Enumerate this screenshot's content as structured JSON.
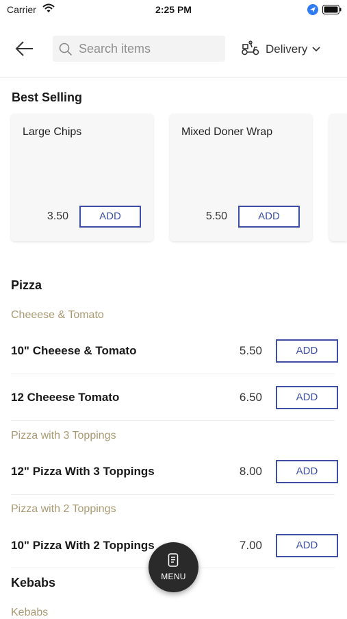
{
  "status_bar": {
    "carrier": "Carrier",
    "time": "2:25 PM"
  },
  "header": {
    "search_placeholder": "Search items",
    "delivery_label": "Delivery"
  },
  "best_selling": {
    "title": "Best Selling",
    "items": [
      {
        "name": "Large Chips",
        "price": "3.50",
        "button": "ADD"
      },
      {
        "name": "Mixed Doner Wrap",
        "price": "5.50",
        "button": "ADD"
      }
    ]
  },
  "pizza": {
    "title": "Pizza",
    "cat1": "Cheeese & Tomato",
    "cat2": "Pizza with 3 Toppings",
    "cat3": "Pizza with 2 Toppings",
    "items": [
      {
        "name": "10\" Cheeese & Tomato",
        "price": "5.50",
        "button": "ADD"
      },
      {
        "name": "12 Cheeese Tomato",
        "price": "6.50",
        "button": "ADD"
      },
      {
        "name": "12\" Pizza With 3 Toppings",
        "price": "8.00",
        "button": "ADD"
      },
      {
        "name": "10\" Pizza With 2 Toppings",
        "price": "7.00",
        "button": "ADD"
      }
    ]
  },
  "kebabs": {
    "title": "Kebabs",
    "cat1": "Kebabs"
  },
  "menu_fab": {
    "label": "MENU"
  },
  "colors": {
    "accent": "#3c4fa3",
    "category": "#a99a72",
    "fab": "#2a2a2a"
  }
}
